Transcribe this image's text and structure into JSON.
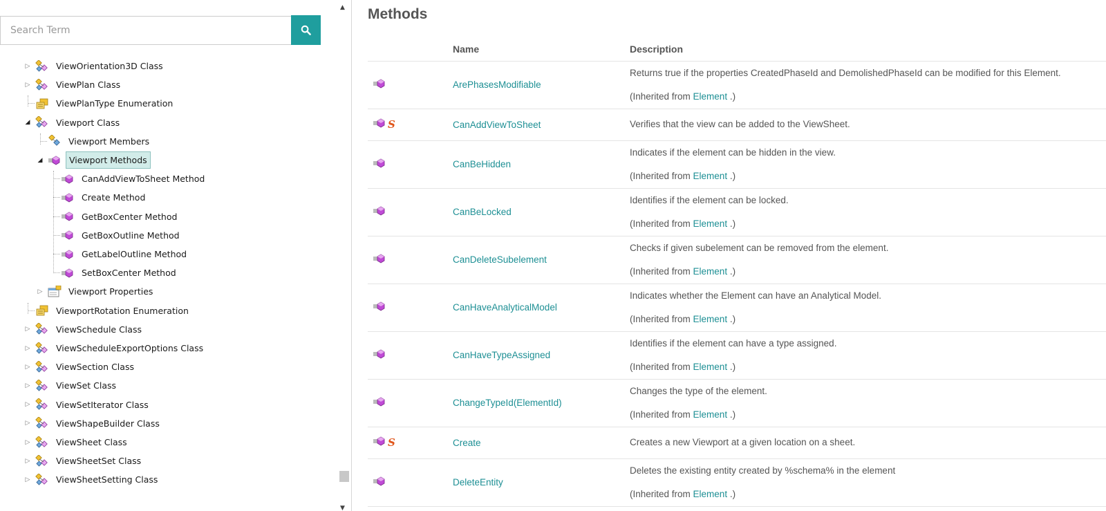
{
  "search": {
    "placeholder": "Search Term"
  },
  "tree": {
    "items": [
      {
        "label": "ViewOrientation3D Class",
        "icon": "class-icon",
        "level": 0,
        "toggle": "collapsed"
      },
      {
        "label": "ViewPlan Class",
        "icon": "class-icon",
        "level": 0,
        "toggle": "collapsed"
      },
      {
        "label": "ViewPlanType Enumeration",
        "icon": "enumeration-icon",
        "level": 0,
        "toggle": "none"
      },
      {
        "label": "Viewport Class",
        "icon": "class-icon",
        "level": 0,
        "toggle": "expanded"
      },
      {
        "label": "Viewport Members",
        "icon": "members-icon",
        "level": 1,
        "toggle": "none"
      },
      {
        "label": "Viewport Methods",
        "icon": "method-icon",
        "level": 1,
        "toggle": "expanded",
        "selected": true
      },
      {
        "label": "CanAddViewToSheet Method",
        "icon": "method-icon",
        "level": 2,
        "toggle": "none"
      },
      {
        "label": "Create Method",
        "icon": "method-icon",
        "level": 2,
        "toggle": "none"
      },
      {
        "label": "GetBoxCenter Method",
        "icon": "method-icon",
        "level": 2,
        "toggle": "none"
      },
      {
        "label": "GetBoxOutline Method",
        "icon": "method-icon",
        "level": 2,
        "toggle": "none"
      },
      {
        "label": "GetLabelOutline Method",
        "icon": "method-icon",
        "level": 2,
        "toggle": "none"
      },
      {
        "label": "SetBoxCenter Method",
        "icon": "method-icon",
        "level": 2,
        "toggle": "none"
      },
      {
        "label": "Viewport Properties",
        "icon": "properties-icon",
        "level": 1,
        "toggle": "collapsed"
      },
      {
        "label": "ViewportRotation Enumeration",
        "icon": "enumeration-icon",
        "level": 0,
        "toggle": "none"
      },
      {
        "label": "ViewSchedule Class",
        "icon": "class-icon",
        "level": 0,
        "toggle": "collapsed"
      },
      {
        "label": "ViewScheduleExportOptions Class",
        "icon": "class-icon",
        "level": 0,
        "toggle": "collapsed"
      },
      {
        "label": "ViewSection Class",
        "icon": "class-icon",
        "level": 0,
        "toggle": "collapsed"
      },
      {
        "label": "ViewSet Class",
        "icon": "class-icon",
        "level": 0,
        "toggle": "collapsed"
      },
      {
        "label": "ViewSetIterator Class",
        "icon": "class-icon",
        "level": 0,
        "toggle": "collapsed"
      },
      {
        "label": "ViewShapeBuilder Class",
        "icon": "class-icon",
        "level": 0,
        "toggle": "collapsed"
      },
      {
        "label": "ViewSheet Class",
        "icon": "class-icon",
        "level": 0,
        "toggle": "collapsed"
      },
      {
        "label": "ViewSheetSet Class",
        "icon": "class-icon",
        "level": 0,
        "toggle": "collapsed"
      },
      {
        "label": "ViewSheetSetting Class",
        "icon": "class-icon",
        "level": 0,
        "toggle": "collapsed"
      }
    ]
  },
  "main": {
    "title": "Methods",
    "columns": {
      "name": "Name",
      "description": "Description"
    },
    "inherited_prefix": "(Inherited from ",
    "inherited_suffix": " .)",
    "static_marker": "S",
    "methods": [
      {
        "name": "ArePhasesModifiable",
        "static": false,
        "description": "Returns true if the properties CreatedPhaseId and DemolishedPhaseId can be modified for this Element.",
        "inherited_from": "Element"
      },
      {
        "name": "CanAddViewToSheet",
        "static": true,
        "description": "Verifies that the view can be added to the ViewSheet.",
        "inherited_from": null
      },
      {
        "name": "CanBeHidden",
        "static": false,
        "description": "Indicates if the element can be hidden in the view.",
        "inherited_from": "Element"
      },
      {
        "name": "CanBeLocked",
        "static": false,
        "description": "Identifies if the element can be locked.",
        "inherited_from": "Element"
      },
      {
        "name": "CanDeleteSubelement",
        "static": false,
        "description": "Checks if given subelement can be removed from the element.",
        "inherited_from": "Element"
      },
      {
        "name": "CanHaveAnalyticalModel",
        "static": false,
        "description": "Indicates whether the Element can have an Analytical Model.",
        "inherited_from": "Element"
      },
      {
        "name": "CanHaveTypeAssigned",
        "static": false,
        "description": "Identifies if the element can have a type assigned.",
        "inherited_from": "Element"
      },
      {
        "name": "ChangeTypeId(ElementId)",
        "static": false,
        "description": "Changes the type of the element.",
        "inherited_from": "Element"
      },
      {
        "name": "Create",
        "static": true,
        "description": "Creates a new Viewport at a given location on a sheet.",
        "inherited_from": null
      },
      {
        "name": "DeleteEntity",
        "static": false,
        "description": "Deletes the existing entity created by %schema% in the element",
        "inherited_from": "Element"
      }
    ]
  },
  "colors": {
    "accent": "#1f9e9e",
    "link": "#1d8f94",
    "static_marker": "#e0561b",
    "selected_bg": "#d2ece9"
  }
}
